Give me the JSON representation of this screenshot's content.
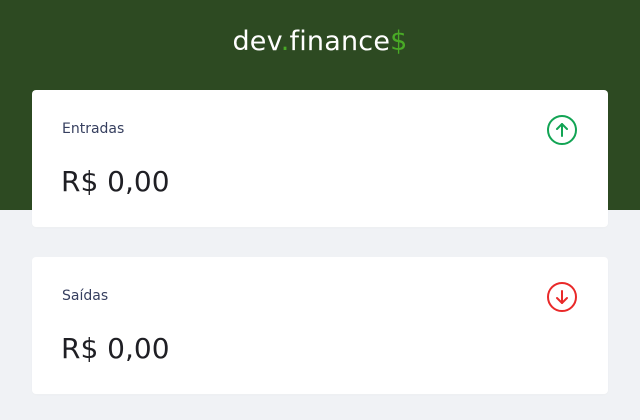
{
  "header": {
    "logo": {
      "part1": "dev",
      "dot": ".",
      "part2": "finance",
      "dollar": "$"
    }
  },
  "cards": {
    "income": {
      "label": "Entradas",
      "value": "R$ 0,00",
      "icon": "arrow-up-circle-icon",
      "icon_color": "#12a454"
    },
    "expense": {
      "label": "Saídas",
      "value": "R$ 0,00",
      "icon": "arrow-down-circle-icon",
      "icon_color": "#e92929"
    }
  },
  "colors": {
    "header_bg": "#2d4a22",
    "accent": "#49aa26",
    "page_bg": "#f0f2f5"
  }
}
